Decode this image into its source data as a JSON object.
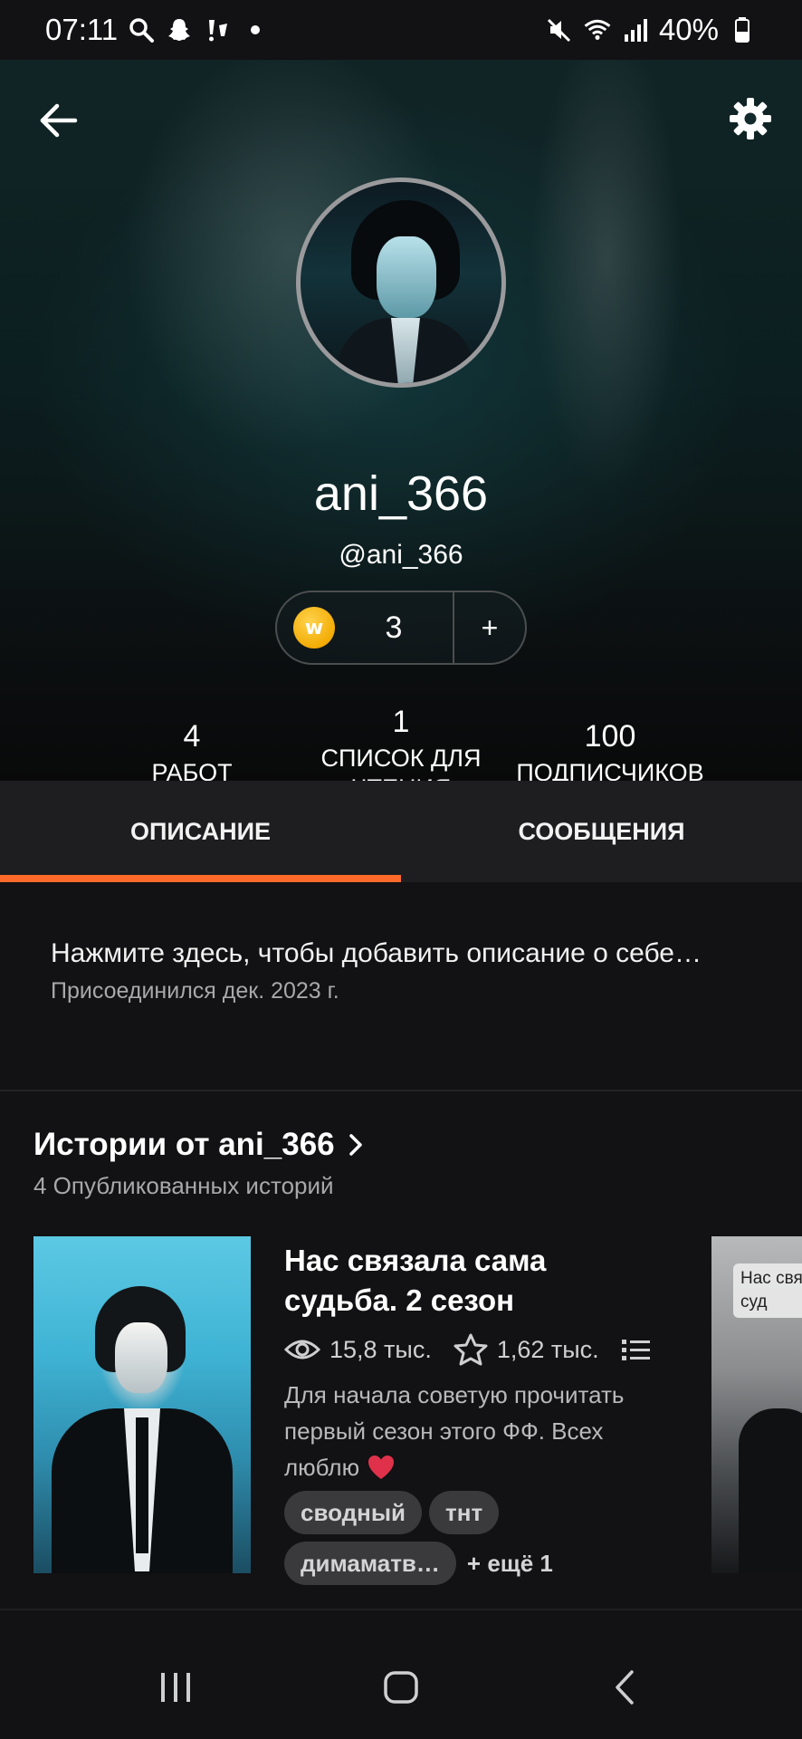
{
  "status_bar": {
    "time": "07:11",
    "battery": "40%",
    "icons_left": [
      "search-icon",
      "snapchat-icon",
      "notification-icon",
      "dot-icon"
    ],
    "icons_right": [
      "mute-icon",
      "wifi-icon",
      "signal-icon",
      "battery-icon"
    ]
  },
  "profile": {
    "display_name": "ani_366",
    "handle": "@ani_366",
    "coins": "3",
    "coins_add": "+"
  },
  "stats": {
    "works_value": "4",
    "works_label": "РАБОТ",
    "reading_value": "1",
    "reading_label_line1": "СПИСОК ДЛЯ",
    "reading_label_line2": "ЧТЕНИЯ",
    "followers_value": "100",
    "followers_label": "ПОДПИСЧИКОВ"
  },
  "tabs": {
    "about": "ОПИСАНИЕ",
    "messages": "СООБЩЕНИЯ",
    "active": "about",
    "accent": "#ff6a2b"
  },
  "about": {
    "description_prompt": "Нажмите здесь, чтобы добавить описание о себе…",
    "joined": "Присоединился дек. 2023 г."
  },
  "stories": {
    "title": "Истории от ani_366",
    "subtitle": "4 Опубликованных историй",
    "items": [
      {
        "title_line1": "Нас связала сама",
        "title_line2": "судьба. 2 сезон",
        "reads": "15,8 тыс.",
        "votes": "1,62 тыс.",
        "description_line1": "Для начала советую прочитать",
        "description_line2": "первый сезон этого ФФ. Всех",
        "description_line3": "люблю",
        "tags": [
          "сводный",
          "тнт",
          "димаматв…"
        ],
        "more_tags": "+ ещё 1"
      }
    ],
    "next_cover_text": "Нас свя суд"
  },
  "nav_bar": {
    "buttons": [
      "recent-apps",
      "home",
      "back"
    ]
  }
}
